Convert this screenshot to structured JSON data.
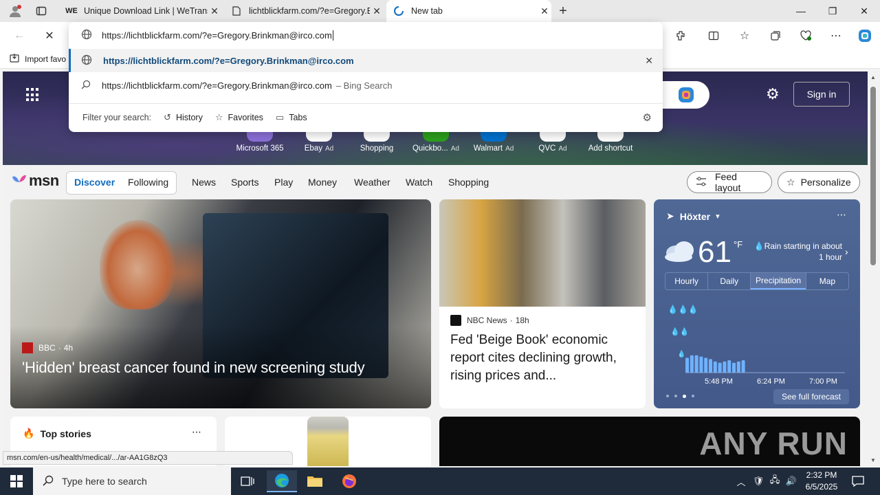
{
  "browser": {
    "tabs": [
      {
        "label": "Unique Download Link | WeTrans",
        "favicon": "WE"
      },
      {
        "label": "lichtblickfarm.com/?e=Gregory.B",
        "favicon": ""
      },
      {
        "label": "New tab",
        "favicon": ""
      }
    ],
    "new_tab_symbol": "+",
    "import_favorites_label": "Import favo"
  },
  "omnibox": {
    "value": "https://lichtblickfarm.com/?e=Gregory.Brinkman@irco.com",
    "suggestion_url": "https://lichtblickfarm.com/?e=Gregory.Brinkman@irco.com",
    "suggestion_search_query": "https://lichtblickfarm.com/?e=Gregory.Brinkman@irco.com",
    "suggestion_search_suffix": "– Bing Search",
    "filter_label": "Filter your search:",
    "filters": [
      "History",
      "Favorites",
      "Tabs"
    ]
  },
  "hero": {
    "signin_label": "Sign in",
    "shortcuts": [
      {
        "label": "Microsoft 365",
        "ad": ""
      },
      {
        "label": "Ebay",
        "ad": "Ad"
      },
      {
        "label": "Shopping",
        "ad": ""
      },
      {
        "label": "Quickbo...",
        "ad": "Ad"
      },
      {
        "label": "Walmart",
        "ad": "Ad"
      },
      {
        "label": "QVC",
        "ad": "Ad"
      },
      {
        "label": "Add shortcut",
        "ad": ""
      }
    ]
  },
  "msn": {
    "logo": "msn",
    "tabs": [
      "Discover",
      "Following"
    ],
    "nav": [
      "News",
      "Sports",
      "Play",
      "Money",
      "Weather",
      "Watch",
      "Shopping"
    ],
    "feed_layout_label": "Feed layout",
    "personalize_label": "Personalize"
  },
  "news_main": {
    "source": "BBC",
    "time": "4h",
    "headline": "'Hidden' breast cancer found in new screening study"
  },
  "news_second": {
    "source": "NBC News",
    "time": "18h",
    "headline": "Fed 'Beige Book' economic report cites declining growth, rising prices and..."
  },
  "weather": {
    "location": "Höxter",
    "temp": "61",
    "unit": "°F",
    "summary": "Rain starting in about 1 hour",
    "tabs": [
      "Hourly",
      "Daily",
      "Precipitation",
      "Map"
    ],
    "active_tab": "Precipitation",
    "times": [
      "5:48 PM",
      "6:24 PM",
      "7:00 PM"
    ],
    "see_full": "See full forecast",
    "precip_levels": [
      0.6,
      0.7,
      0.7,
      0.65,
      0.6,
      0.55,
      0.45,
      0.4,
      0.45,
      0.5,
      0.4,
      0.45,
      0.5
    ]
  },
  "top_stories": {
    "title": "Top stories"
  },
  "status_url": "msn.com/en-us/health/medical/.../ar-AA1G8zQ3",
  "watermark": "ANY RUN",
  "taskbar": {
    "search_placeholder": "Type here to search",
    "time": "2:32 PM",
    "date": "6/5/2025"
  }
}
